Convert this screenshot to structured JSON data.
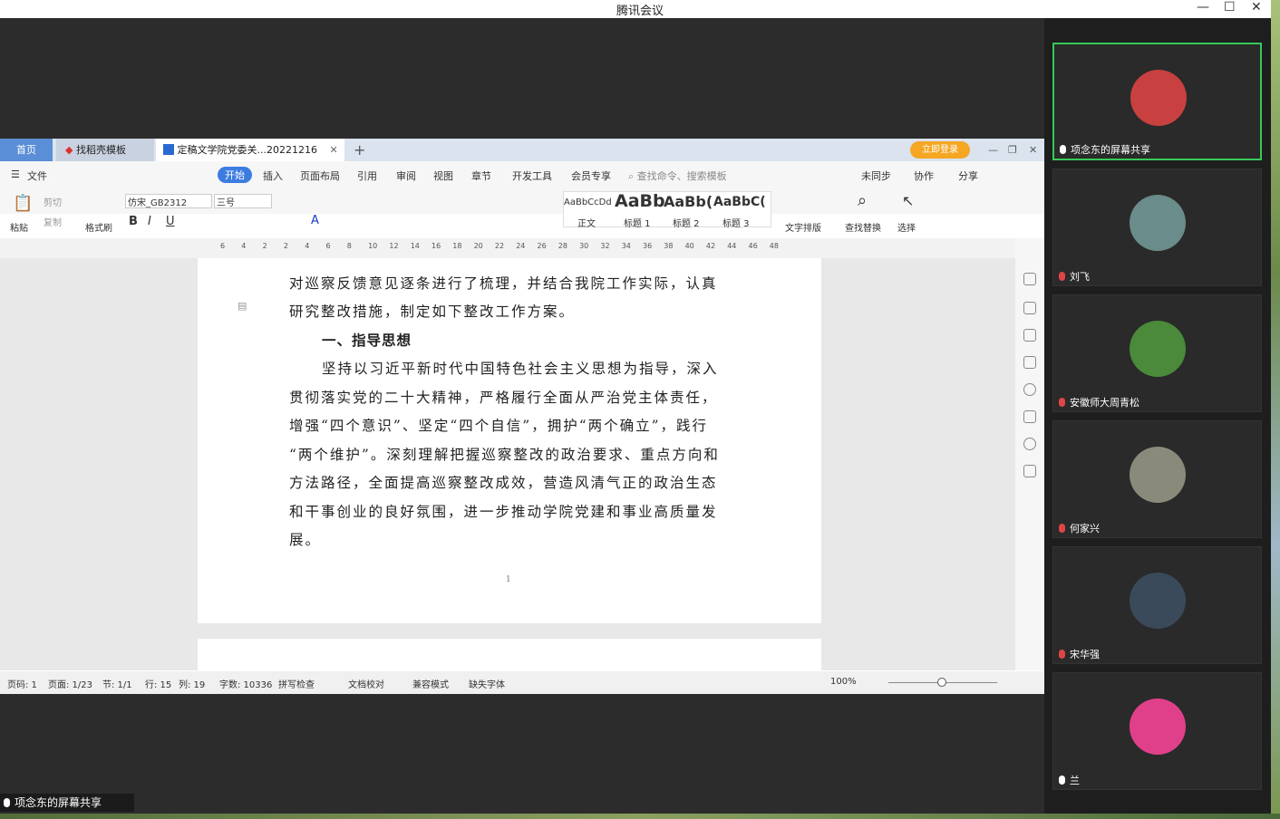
{
  "meeting": {
    "title": "腾讯会议",
    "share_label": "项念东的屏幕共享"
  },
  "wps": {
    "tabs": [
      {
        "label": "首页"
      },
      {
        "label": "找稻壳模板"
      },
      {
        "label": "定稿文学院党委关...20221216"
      }
    ],
    "login_label": "立即登录",
    "menu": [
      "文件",
      "开始",
      "插入",
      "页面布局",
      "引用",
      "审阅",
      "视图",
      "章节",
      "开发工具",
      "会员专享"
    ],
    "search_placeholder": "查找命令、搜索模板",
    "sync": "未同步",
    "collab": "协作",
    "share": "分享",
    "toolbar": {
      "paste": "粘贴",
      "cut": "剪切",
      "copy": "复制",
      "format_painter": "格式刷",
      "font": "仿宋_GB2312",
      "size": "三号",
      "styles": [
        {
          "preview": "AaBbCcDd",
          "name": "正文"
        },
        {
          "preview": "AaBb",
          "name": "标题 1"
        },
        {
          "preview": "AaBb(",
          "name": "标题 2"
        },
        {
          "preview": "AaBbC(",
          "name": "标题 3"
        }
      ],
      "text_layout": "文字排版",
      "find_replace": "查找替换",
      "select": "选择"
    },
    "ruler": [
      "6",
      "4",
      "2",
      "2",
      "4",
      "6",
      "8",
      "10",
      "12",
      "14",
      "16",
      "18",
      "20",
      "22",
      "24",
      "26",
      "28",
      "30",
      "32",
      "34",
      "36",
      "38",
      "40",
      "42",
      "44",
      "46",
      "48"
    ],
    "doc": {
      "lines": [
        "对巡察反馈意见逐条进行了梳理，并结合我院工作实际，认真",
        "研究整改措施，制定如下整改工作方案。"
      ],
      "heading": "一、指导思想",
      "body": [
        "坚持以习近平新时代中国特色社会主义思想为指导，深入",
        "贯彻落实党的二十大精神，严格履行全面从严治党主体责任，",
        "增强“四个意识”、坚定“四个自信”，拥护“两个确立”，践行",
        "“两个维护”。深刻理解把握巡察整改的政治要求、重点方向和",
        "方法路径，全面提高巡察整改成效，营造风清气正的政治生态",
        "和干事创业的良好氛围，进一步推动学院党建和事业高质量发",
        "展。"
      ],
      "page_number": "1"
    },
    "status": {
      "line_no": "页码: 1",
      "page": "页面: 1/23",
      "section": "节: 1/1",
      "row": "行: 15",
      "col": "列: 19",
      "words": "字数: 10336",
      "spell": "拼写检查",
      "proof": "文档校对",
      "compat": "兼容模式",
      "missing_font": "缺失字体",
      "zoom": "100%"
    }
  },
  "participants": [
    {
      "name": "项念东的屏幕共享",
      "muted": false,
      "avatar_color": "#c94040"
    },
    {
      "name": "刘飞",
      "muted": true,
      "avatar_color": "#6a8c8a"
    },
    {
      "name": "安徽师大周青松",
      "muted": true,
      "avatar_color": "#4a8a3a"
    },
    {
      "name": "何家兴",
      "muted": true,
      "avatar_color": "#8a8a7a"
    },
    {
      "name": "宋华强",
      "muted": true,
      "avatar_color": "#3a4a5a"
    },
    {
      "name": "兰",
      "muted": false,
      "avatar_color": "#e0408a"
    }
  ]
}
